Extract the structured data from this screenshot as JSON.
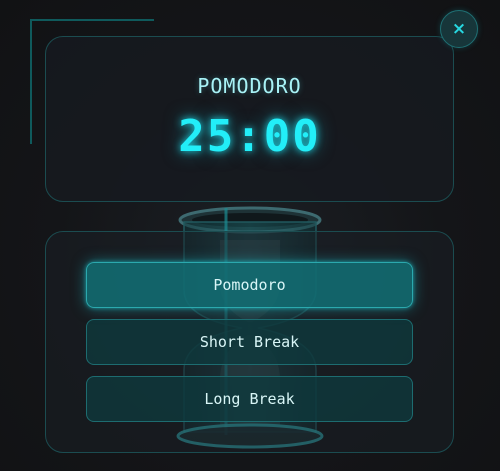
{
  "timer": {
    "mode_label": "POMODORO",
    "time": "25:00"
  },
  "controls": {
    "close_icon": "×",
    "modes": [
      {
        "label": "Pomodoro",
        "active": true
      },
      {
        "label": "Short Break",
        "active": false
      },
      {
        "label": "Long Break",
        "active": false
      }
    ]
  },
  "icons": {
    "close": "close-icon",
    "hourglass": "hourglass-icon"
  },
  "colors": {
    "accent": "#22eef8",
    "active_button": "#127075",
    "button": "#0e3a3e",
    "border": "#1b4c50",
    "background": "#141518"
  }
}
